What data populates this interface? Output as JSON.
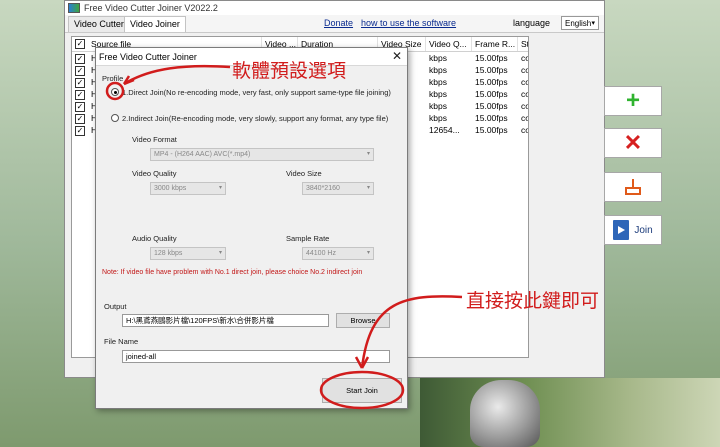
{
  "window": {
    "title": "Free Video Cutter Joiner V2022.2"
  },
  "tabs": [
    {
      "label": "Video Cutter"
    },
    {
      "label": "Video Joiner"
    }
  ],
  "links": {
    "donate": "Donate",
    "howto": "how to use the software"
  },
  "language": {
    "label": "language",
    "value": "English"
  },
  "table": {
    "columns": [
      "Source file",
      "Video ...",
      "Duration",
      "Video Size",
      "Video Q...",
      "Frame R...",
      "Status"
    ],
    "rows": [
      {
        "source": "H:\\",
        "quality": "kbps",
        "frame": "15.00fps",
        "status": "com..."
      },
      {
        "source": "H:\\",
        "quality": "kbps",
        "frame": "15.00fps",
        "status": "com..."
      },
      {
        "source": "H:\\",
        "quality": "kbps",
        "frame": "15.00fps",
        "status": "com..."
      },
      {
        "source": "H:\\",
        "quality": "kbps",
        "frame": "15.00fps",
        "status": "com..."
      },
      {
        "source": "H:\\",
        "quality": "kbps",
        "frame": "15.00fps",
        "status": "com..."
      },
      {
        "source": "H:\\",
        "quality": "kbps",
        "frame": "15.00fps",
        "status": "com..."
      },
      {
        "source": "H:\\",
        "quality": "12654...",
        "frame": "15.00fps",
        "status": "com..."
      }
    ]
  },
  "side_buttons": {
    "join": "Join"
  },
  "icons": {
    "add": "plus-icon",
    "remove": "x-icon",
    "clear": "broom-icon",
    "join": "film-icon"
  },
  "dialog": {
    "title": "Free Video Cutter Joiner",
    "close": "✕",
    "profile_label": "Profile",
    "option1": "1.Direct Join(No re-encoding mode, very fast, only support same-type file joining)",
    "option2": "2.Indirect Join(Re-encoding mode, very slowly, support any format, any type file)",
    "video_format_label": "Video Format",
    "video_format_value": "MP4 - (H264 AAC) AVC(*.mp4)",
    "video_quality_label": "Video Quality",
    "video_quality_value": "3000 kbps",
    "video_size_label": "Video Size",
    "video_size_value": "3840*2160",
    "audio_quality_label": "Audio Quality",
    "audio_quality_value": "128 kbps",
    "sample_rate_label": "Sample Rate",
    "sample_rate_value": "44100 Hz",
    "note": "Note: If video file have problem with No.1 direct join, please choice No.2 indirect join",
    "output_label": "Output",
    "output_value": "H:\\黑鳶燕鷗影片檔\\120FPS\\新水\\合併影片檔",
    "browse": "Browse",
    "filename_label": "File Name",
    "filename_value": "joined-all",
    "start_join": "Start Join"
  },
  "annotations": {
    "default_setting": "軟體預設選項",
    "click_here": "直接按此鍵即可"
  },
  "colors": {
    "annotation": "#d11c1c",
    "add": "#2fb32f",
    "remove": "#d62020",
    "clear": "#e05a1a",
    "join": "#2e66b8"
  }
}
